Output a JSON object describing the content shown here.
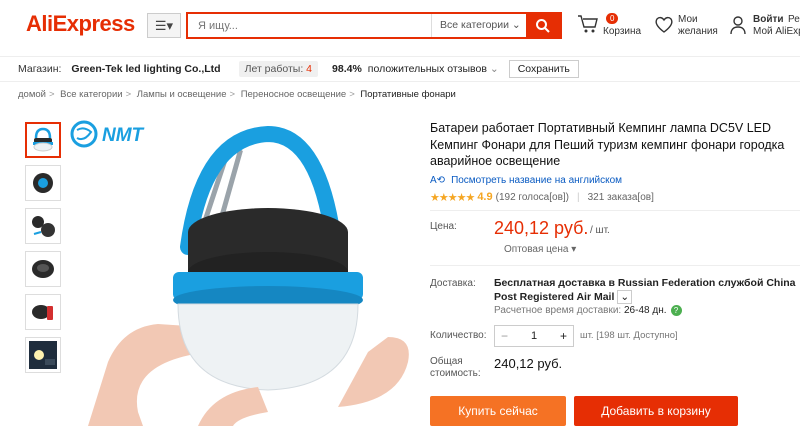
{
  "header": {
    "logo": "AliExpress",
    "search_placeholder": "Я ищу...",
    "search_category": "Все категории",
    "cart_count": "0",
    "cart_label": "Корзина",
    "wishlist_line1": "Мои",
    "wishlist_line2": "желания",
    "signin_line1": "Войти",
    "signin_line2": "Мой AliExpress",
    "reg": "Ре"
  },
  "store": {
    "label": "Магазин:",
    "name": "Green-Tek led lighting Co.,Ltd",
    "years_label": "Лет работы:",
    "years": "4",
    "feedback_pct": "98.4%",
    "feedback_label": "положительных отзывов",
    "save_label": "Сохранить"
  },
  "breadcrumb": [
    "домой",
    "Все категории",
    "Лампы и освещение",
    "Переносное освещение",
    "Портативные фонари"
  ],
  "product": {
    "brand_logo": "NMT",
    "title": "Батареи работает Портативный Кемпинг лампа DC5V LED Кемпинг Фонари для Пеший туризм кемпинг фонари городка аварийное освещение",
    "translate_label": "Посмотреть название на английском",
    "rating": "4.9",
    "votes": "(192 голоса[ов])",
    "orders": "321 заказа[ов]",
    "price_label": "Цена:",
    "price": "240,12 руб.",
    "unit": "/ шт.",
    "wholesale": "Оптовая цена",
    "shipping_label": "Доставка:",
    "shipping_text": "Бесплатная доставка в Russian Federation службой China Post Registered Air Mail",
    "ship_time_label": "Расчетное время доставки:",
    "ship_time": "26-48 дн.",
    "qty_label": "Количество:",
    "qty_value": "1",
    "qty_note": "шт. [198 шт. Доступно]",
    "total_label_1": "Общая",
    "total_label_2": "стоимость:",
    "total": "240,12 руб.",
    "buy_label": "Купить сейчас",
    "cart_label": "Добавить в корзину"
  },
  "colors": {
    "accent": "#e62e04",
    "buy": "#f57224",
    "lamp_blue": "#1a9fe0",
    "lamp_black": "#2a2a2a"
  }
}
